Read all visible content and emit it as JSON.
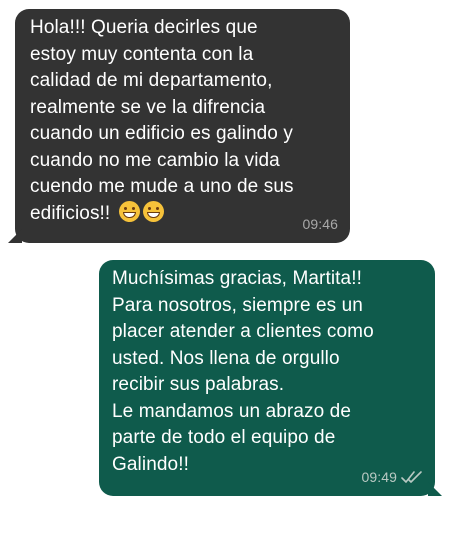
{
  "messages": [
    {
      "direction": "incoming",
      "lines": [
        "Hola!!! Queria decirles que",
        "estoy muy contenta con la",
        "calidad de mi departamento,",
        "realmente se ve la difrencia",
        "cuando un edificio es galindo y",
        "cuando no me cambio la vida",
        "cuendo me mude a uno de sus",
        "edificios!!"
      ],
      "emojis": [
        "grinning-face",
        "grinning-face"
      ],
      "time": "09:46"
    },
    {
      "direction": "outgoing",
      "lines": [
        "Muchísimas gracias, Martita!!",
        "Para nosotros, siempre es un",
        "placer atender a clientes como",
        "usted. Nos llena de orgullo",
        "recibir sus palabras.",
        "Le mandamos un abrazo de",
        "parte de todo el equipo de",
        "Galindo!!"
      ],
      "time": "09:49",
      "status_icon": "double-check-read-icon"
    }
  ],
  "colors": {
    "incoming_bubble": "#333333",
    "outgoing_bubble": "#0f5b4c",
    "text": "#ffffff",
    "background": "#ffffff"
  }
}
